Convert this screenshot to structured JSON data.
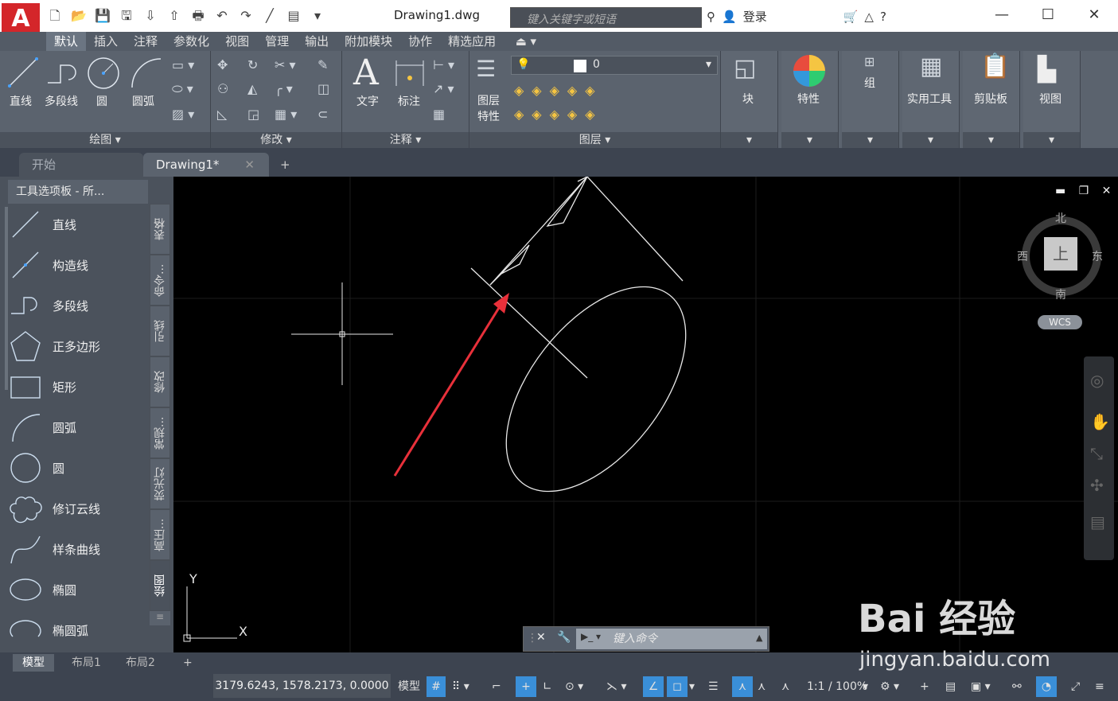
{
  "app": {
    "logo": "A",
    "title": "Drawing1.dwg"
  },
  "search": {
    "placeholder": "键入关键字或短语"
  },
  "account": {
    "login": "登录"
  },
  "ribbon_tabs": [
    "默认",
    "插入",
    "注释",
    "参数化",
    "视图",
    "管理",
    "输出",
    "附加模块",
    "协作",
    "精选应用"
  ],
  "draw_panel": {
    "tools": [
      "直线",
      "多段线",
      "圆",
      "圆弧"
    ],
    "footer": "绘图 ▾"
  },
  "modify_panel": {
    "footer": "修改 ▾"
  },
  "annot_panel": {
    "tools": [
      "文字",
      "标注"
    ],
    "footer": "注释 ▾"
  },
  "layer_panel": {
    "tool": "图层\n特性",
    "tool1": "图层",
    "tool2": "特性",
    "current_layer": "0",
    "footer": "图层 ▾"
  },
  "right_panels": [
    "块",
    "特性",
    "组",
    "实用工具",
    "剪贴板",
    "视图"
  ],
  "doc_tabs": {
    "start": "开始",
    "current": "Drawing1*"
  },
  "palette": {
    "title": "工具选项板 - 所...",
    "items": [
      "直线",
      "构造线",
      "多段线",
      "正多边形",
      "矩形",
      "圆弧",
      "圆",
      "修订云线",
      "样条曲线",
      "椭圆",
      "椭圆弧"
    ],
    "side_tabs": [
      "表格",
      "命令...",
      "引线",
      "修改",
      "常规...",
      "荧光灯",
      "高压...",
      "绘图"
    ]
  },
  "viewcube": {
    "north": "北",
    "south": "南",
    "east": "东",
    "west": "西",
    "face": "上",
    "wcs": "WCS"
  },
  "ucs": {
    "x": "X",
    "y": "Y"
  },
  "command": {
    "placeholder": "键入命令"
  },
  "layout_tabs": [
    "模型",
    "布局1",
    "布局2"
  ],
  "status": {
    "coords": "3179.6243, 1578.2173, 0.0000",
    "model": "模型",
    "scale": "1:1 / 100%"
  },
  "watermark": {
    "brand": "Bai 经验",
    "url": "jingyan.baidu.com"
  }
}
